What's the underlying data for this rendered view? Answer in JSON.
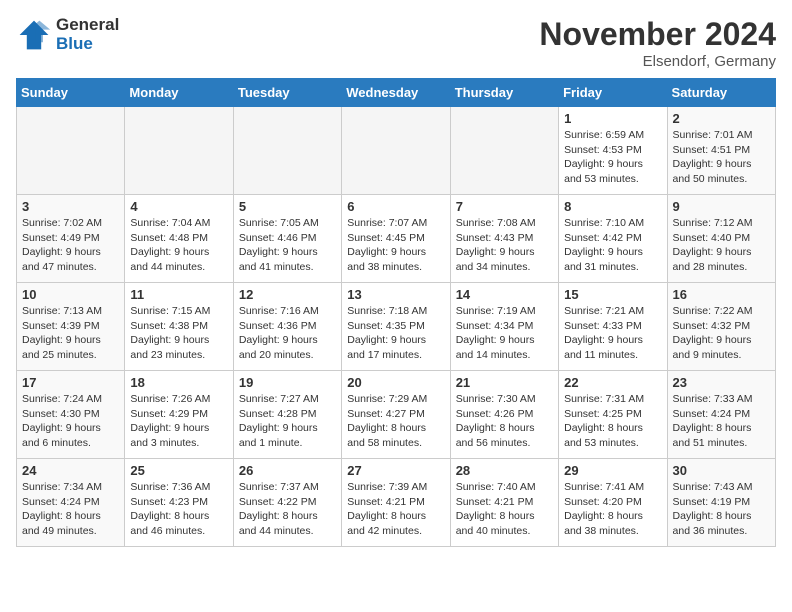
{
  "header": {
    "logo_line1": "General",
    "logo_line2": "Blue",
    "month": "November 2024",
    "location": "Elsendorf, Germany"
  },
  "weekdays": [
    "Sunday",
    "Monday",
    "Tuesday",
    "Wednesday",
    "Thursday",
    "Friday",
    "Saturday"
  ],
  "weeks": [
    [
      {
        "day": "",
        "info": "",
        "empty": true
      },
      {
        "day": "",
        "info": "",
        "empty": true
      },
      {
        "day": "",
        "info": "",
        "empty": true
      },
      {
        "day": "",
        "info": "",
        "empty": true
      },
      {
        "day": "",
        "info": "",
        "empty": true
      },
      {
        "day": "1",
        "info": "Sunrise: 6:59 AM\nSunset: 4:53 PM\nDaylight: 9 hours\nand 53 minutes."
      },
      {
        "day": "2",
        "info": "Sunrise: 7:01 AM\nSunset: 4:51 PM\nDaylight: 9 hours\nand 50 minutes."
      }
    ],
    [
      {
        "day": "3",
        "info": "Sunrise: 7:02 AM\nSunset: 4:49 PM\nDaylight: 9 hours\nand 47 minutes."
      },
      {
        "day": "4",
        "info": "Sunrise: 7:04 AM\nSunset: 4:48 PM\nDaylight: 9 hours\nand 44 minutes."
      },
      {
        "day": "5",
        "info": "Sunrise: 7:05 AM\nSunset: 4:46 PM\nDaylight: 9 hours\nand 41 minutes."
      },
      {
        "day": "6",
        "info": "Sunrise: 7:07 AM\nSunset: 4:45 PM\nDaylight: 9 hours\nand 38 minutes."
      },
      {
        "day": "7",
        "info": "Sunrise: 7:08 AM\nSunset: 4:43 PM\nDaylight: 9 hours\nand 34 minutes."
      },
      {
        "day": "8",
        "info": "Sunrise: 7:10 AM\nSunset: 4:42 PM\nDaylight: 9 hours\nand 31 minutes."
      },
      {
        "day": "9",
        "info": "Sunrise: 7:12 AM\nSunset: 4:40 PM\nDaylight: 9 hours\nand 28 minutes."
      }
    ],
    [
      {
        "day": "10",
        "info": "Sunrise: 7:13 AM\nSunset: 4:39 PM\nDaylight: 9 hours\nand 25 minutes."
      },
      {
        "day": "11",
        "info": "Sunrise: 7:15 AM\nSunset: 4:38 PM\nDaylight: 9 hours\nand 23 minutes."
      },
      {
        "day": "12",
        "info": "Sunrise: 7:16 AM\nSunset: 4:36 PM\nDaylight: 9 hours\nand 20 minutes."
      },
      {
        "day": "13",
        "info": "Sunrise: 7:18 AM\nSunset: 4:35 PM\nDaylight: 9 hours\nand 17 minutes."
      },
      {
        "day": "14",
        "info": "Sunrise: 7:19 AM\nSunset: 4:34 PM\nDaylight: 9 hours\nand 14 minutes."
      },
      {
        "day": "15",
        "info": "Sunrise: 7:21 AM\nSunset: 4:33 PM\nDaylight: 9 hours\nand 11 minutes."
      },
      {
        "day": "16",
        "info": "Sunrise: 7:22 AM\nSunset: 4:32 PM\nDaylight: 9 hours\nand 9 minutes."
      }
    ],
    [
      {
        "day": "17",
        "info": "Sunrise: 7:24 AM\nSunset: 4:30 PM\nDaylight: 9 hours\nand 6 minutes."
      },
      {
        "day": "18",
        "info": "Sunrise: 7:26 AM\nSunset: 4:29 PM\nDaylight: 9 hours\nand 3 minutes."
      },
      {
        "day": "19",
        "info": "Sunrise: 7:27 AM\nSunset: 4:28 PM\nDaylight: 9 hours\nand 1 minute."
      },
      {
        "day": "20",
        "info": "Sunrise: 7:29 AM\nSunset: 4:27 PM\nDaylight: 8 hours\nand 58 minutes."
      },
      {
        "day": "21",
        "info": "Sunrise: 7:30 AM\nSunset: 4:26 PM\nDaylight: 8 hours\nand 56 minutes."
      },
      {
        "day": "22",
        "info": "Sunrise: 7:31 AM\nSunset: 4:25 PM\nDaylight: 8 hours\nand 53 minutes."
      },
      {
        "day": "23",
        "info": "Sunrise: 7:33 AM\nSunset: 4:24 PM\nDaylight: 8 hours\nand 51 minutes."
      }
    ],
    [
      {
        "day": "24",
        "info": "Sunrise: 7:34 AM\nSunset: 4:24 PM\nDaylight: 8 hours\nand 49 minutes."
      },
      {
        "day": "25",
        "info": "Sunrise: 7:36 AM\nSunset: 4:23 PM\nDaylight: 8 hours\nand 46 minutes."
      },
      {
        "day": "26",
        "info": "Sunrise: 7:37 AM\nSunset: 4:22 PM\nDaylight: 8 hours\nand 44 minutes."
      },
      {
        "day": "27",
        "info": "Sunrise: 7:39 AM\nSunset: 4:21 PM\nDaylight: 8 hours\nand 42 minutes."
      },
      {
        "day": "28",
        "info": "Sunrise: 7:40 AM\nSunset: 4:21 PM\nDaylight: 8 hours\nand 40 minutes."
      },
      {
        "day": "29",
        "info": "Sunrise: 7:41 AM\nSunset: 4:20 PM\nDaylight: 8 hours\nand 38 minutes."
      },
      {
        "day": "30",
        "info": "Sunrise: 7:43 AM\nSunset: 4:19 PM\nDaylight: 8 hours\nand 36 minutes."
      }
    ]
  ]
}
